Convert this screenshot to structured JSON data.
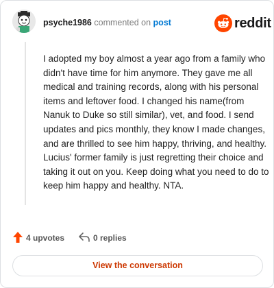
{
  "comment": {
    "username": "psyche1986",
    "commented_text": "commented on",
    "post_link": "post",
    "body": "I adopted my boy almost a year ago from a family who didn't have time for him anymore. They gave me all medical and training records, along with his personal items and leftover food. I changed his name(from Nanuk to Duke so still similar), vet, and food. I send updates and pics monthly, they know I made changes, and are thrilled to see him happy, thriving, and healthy. Lucius' former family is just regretting their choice and taking it out on you. Keep doing what you need to do to keep him happy and healthy. NTA."
  },
  "brand": {
    "name": "reddit",
    "icon": "reddit-logo-icon",
    "color": "#ff4500"
  },
  "actions": {
    "upvotes": "4 upvotes",
    "replies": "0 replies",
    "upvote_icon": "upvote-arrow-icon",
    "reply_icon": "reply-arrow-icon",
    "upvote_color": "#ff4500"
  },
  "cta": {
    "label": "View the conversation",
    "color": "#cc3700"
  }
}
